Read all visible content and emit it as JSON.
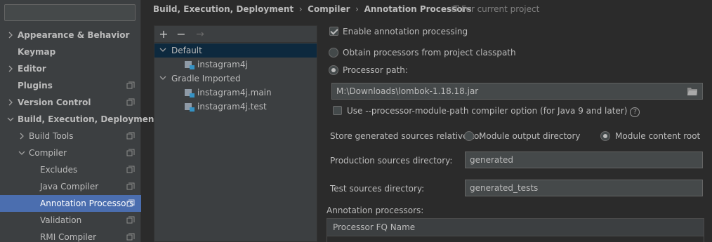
{
  "search": {
    "value": "",
    "placeholder": ""
  },
  "sidebar": {
    "items": [
      {
        "label": "Appearance & Behavior"
      },
      {
        "label": "Keymap"
      },
      {
        "label": "Editor"
      },
      {
        "label": "Plugins"
      },
      {
        "label": "Version Control"
      },
      {
        "label": "Build, Execution, Deployment"
      },
      {
        "label": "Build Tools"
      },
      {
        "label": "Compiler"
      },
      {
        "label": "Excludes"
      },
      {
        "label": "Java Compiler"
      },
      {
        "label": "Annotation Processors"
      },
      {
        "label": "Validation"
      },
      {
        "label": "RMI Compiler"
      }
    ]
  },
  "breadcrumb": [
    "Build, Execution, Deployment",
    "Compiler",
    "Annotation Processors"
  ],
  "scope_hint": "For current project",
  "toolbar": {
    "add": "+",
    "remove": "−",
    "move": "→"
  },
  "tree": [
    {
      "label": "Default"
    },
    {
      "label": "instagram4j"
    },
    {
      "label": "Gradle Imported"
    },
    {
      "label": "instagram4j.main"
    },
    {
      "label": "instagram4j.test"
    }
  ],
  "settings": {
    "enable_label": "Enable annotation processing",
    "obtain_label": "Obtain processors from project classpath",
    "path_label": "Processor path:",
    "path_value": "M:\\Downloads\\lombok-1.18.18.jar",
    "module_path_label": "Use --processor-module-path compiler option (for Java 9 and later)",
    "help_glyph": "?",
    "store_label": "Store generated sources relative to:",
    "store_output_label": "Module output directory",
    "store_content_label": "Module content root",
    "production_label": "Production sources directory:",
    "production_value": "generated",
    "test_label": "Test sources directory:",
    "test_value": "generated_tests",
    "processors_label": "Annotation processors:",
    "table_header": "Processor FQ Name"
  },
  "state": {
    "enable_checked": true,
    "source": "processor-path",
    "module_path_checked": false,
    "store_relative": "module-content-root"
  },
  "colors": {
    "background": "#2b2b2b",
    "sidebar": "#3c3f41",
    "selection": "#4b6eaf",
    "tree_selection": "#0d293e",
    "text": "#bbbbbb"
  }
}
